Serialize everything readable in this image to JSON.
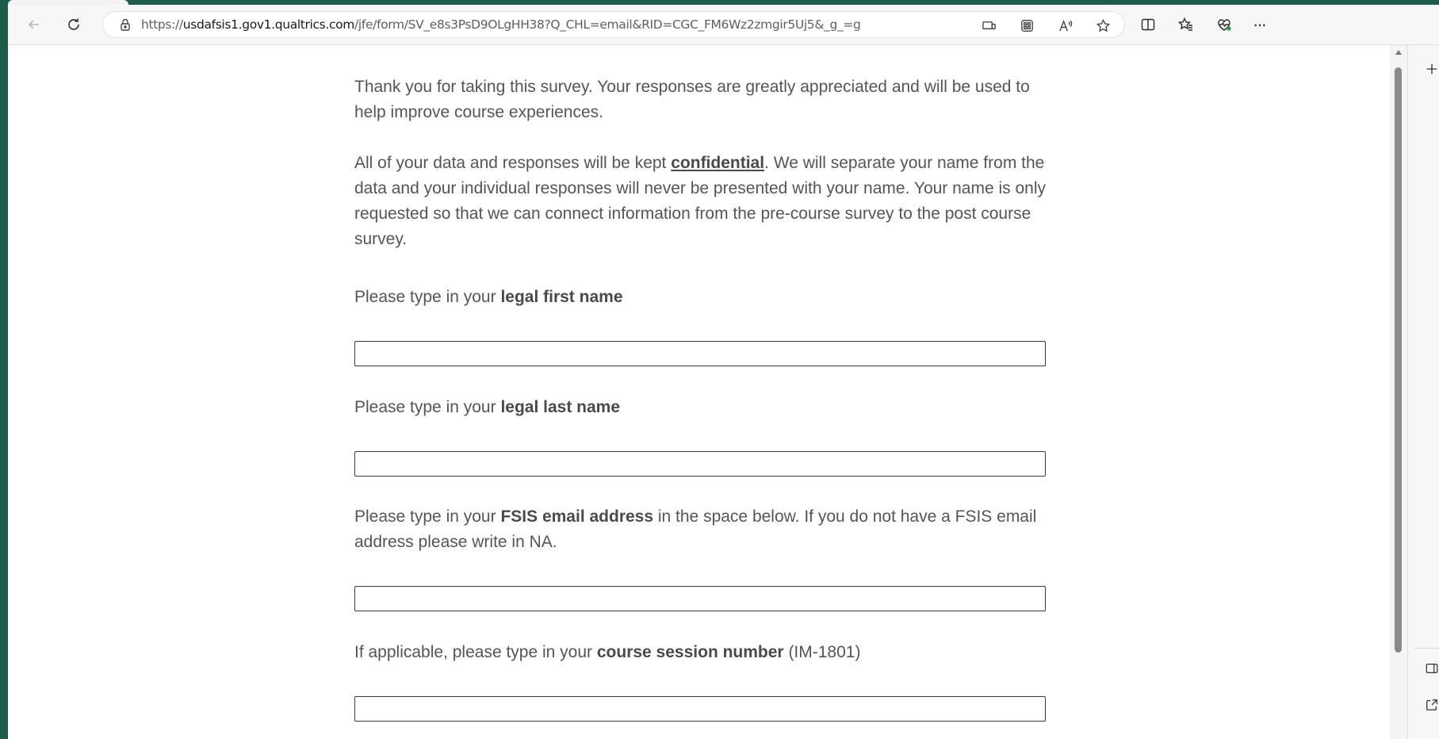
{
  "browser": {
    "url_prefix": "https://",
    "url_host": "usdafsis1.gov1.qualtrics.com",
    "url_path": "/jfe/form/SV_e8s3PsD9OLgHH38?Q_CHL=email&RID=CGC_FM6Wz2zmgir5Uj5&_g_=g",
    "more_menu": "···"
  },
  "survey": {
    "intro_p1": "Thank you for taking this survey. Your responses are greatly appreciated and will be used to help improve course experiences.",
    "intro_p2_before": "All of your data and responses will be kept ",
    "intro_p2_emph": "confidential",
    "intro_p2_after": ". We will separate your name from the data and your individual responses will never be presented with your name. Your name is only requested so that we can connect information from the pre-course survey to the post course survey.",
    "q1_prefix": "Please type in your ",
    "q1_bold": "legal first name",
    "q1_value": "",
    "q2_prefix": "Please type in your ",
    "q2_bold": "legal last name",
    "q2_value": "",
    "q3_prefix": "Please type in your ",
    "q3_bold": "FSIS email address",
    "q3_suffix": " in the space below. If you do not have a FSIS email address please write in NA.",
    "q3_value": "",
    "q4_prefix": "If applicable, please type in your ",
    "q4_bold": "course session number",
    "q4_suffix": " (IM-1801)",
    "q4_value": ""
  },
  "icons": {
    "toolbar": [
      "back-icon",
      "refresh-icon",
      "lock-icon",
      "cast-icon",
      "apps-icon",
      "read-aloud-icon",
      "favorite-star-icon",
      "split-screen-icon",
      "favorites-icon",
      "browser-essentials-icon",
      "more-icon"
    ],
    "sidebar": [
      "add-icon",
      "sidebar-toggle-icon",
      "external-link-icon"
    ]
  },
  "colors": {
    "frame": "#1e5c4a",
    "text": "#555555",
    "input_border": "#3a3a3a"
  }
}
